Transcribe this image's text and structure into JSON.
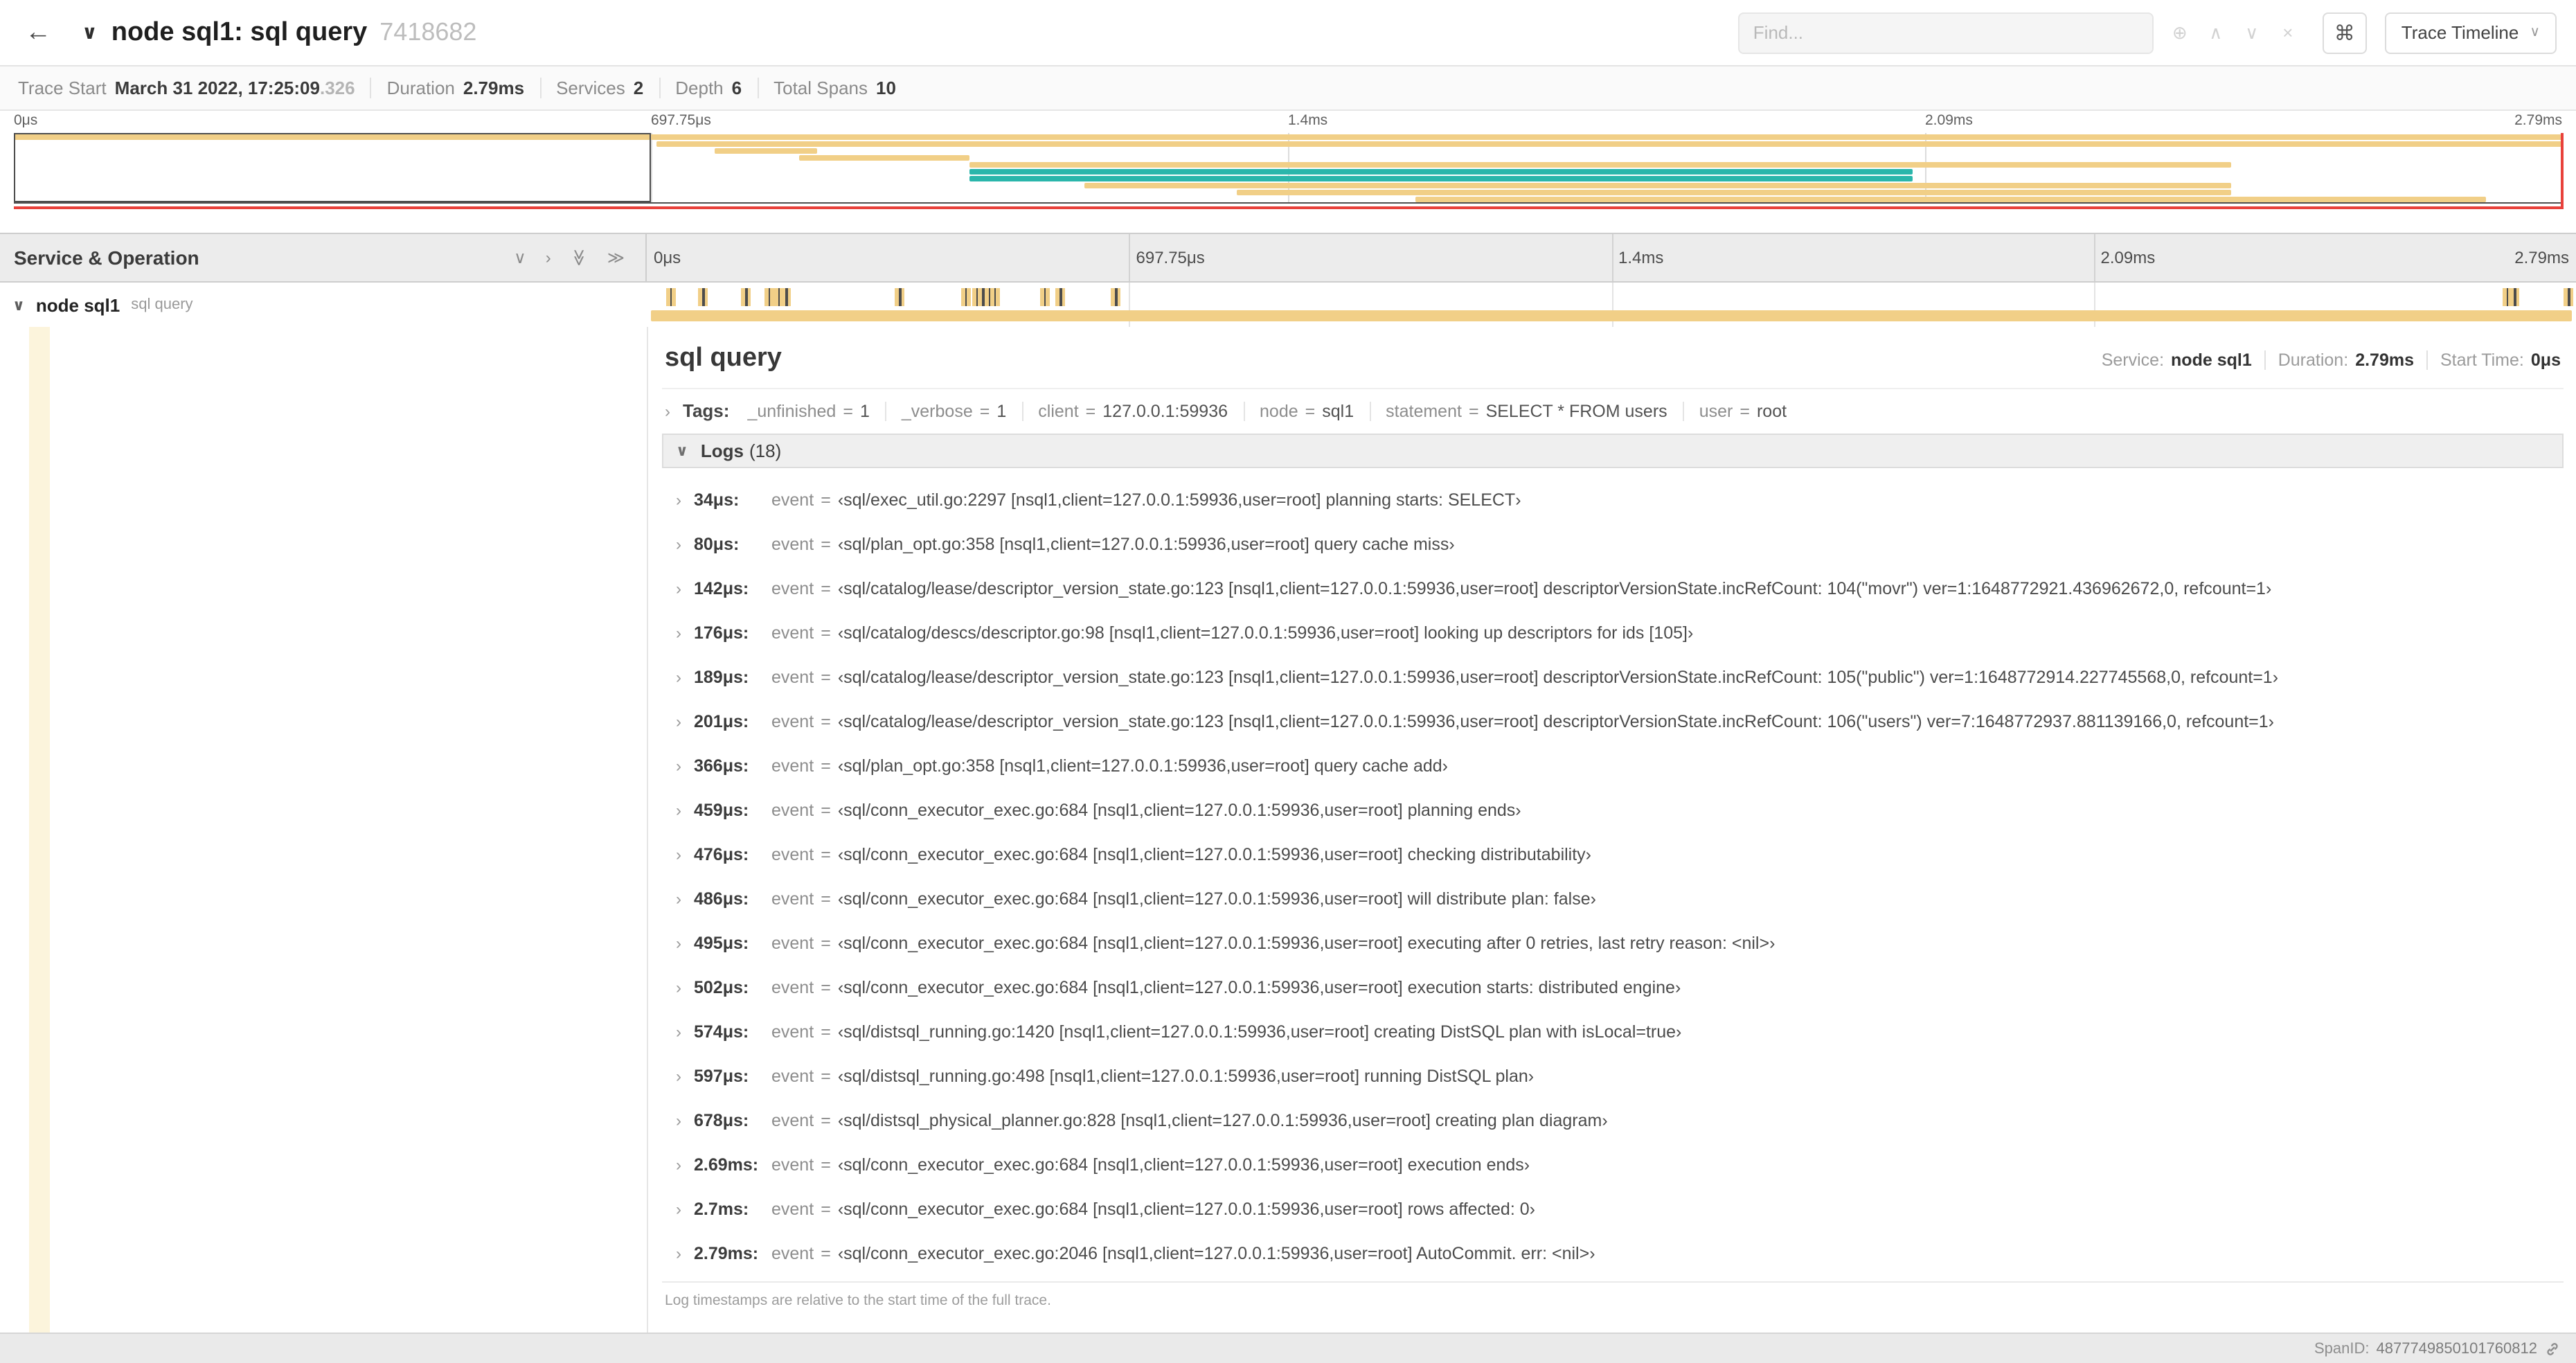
{
  "colors": {
    "amber": "#f1cf87",
    "teal": "#2ab6ab",
    "accent_red": "#e8413b",
    "indent": "#fcf4dc"
  },
  "icons": {
    "back": "←",
    "collapse": "∨",
    "expander": "›",
    "chevron_down": "∨",
    "chevron_right": "›",
    "dbl_chevron": "≫",
    "focus": "⊕",
    "prev": "∧",
    "next": "∨",
    "clear": "×",
    "cmd": "⌘",
    "dropdown": "∨"
  },
  "header": {
    "title": "node sql1: sql query",
    "trace_id": "7418682",
    "find_placeholder": "Find...",
    "view_select_label": "Trace Timeline"
  },
  "trace_info": {
    "items": [
      {
        "label": "Trace Start",
        "value": "March 31 2022, 17:25:09",
        "value_suffix": ".326"
      },
      {
        "label": "Duration",
        "value": "2.79ms"
      },
      {
        "label": "Services",
        "value": "2"
      },
      {
        "label": "Depth",
        "value": "6"
      },
      {
        "label": "Total Spans",
        "value": "10"
      }
    ]
  },
  "minimap": {
    "spans": [
      {
        "start": 0,
        "end": 100,
        "color": "amber"
      },
      {
        "start": 25.2,
        "end": 100,
        "color": "amber"
      },
      {
        "start": 27.5,
        "end": 31.5,
        "color": "amber"
      },
      {
        "start": 30.8,
        "end": 37.5,
        "color": "amber"
      },
      {
        "start": 37.5,
        "end": 87,
        "color": "amber"
      },
      {
        "start": 37.5,
        "end": 74.5,
        "color": "teal"
      },
      {
        "start": 37.5,
        "end": 74.5,
        "color": "teal"
      },
      {
        "start": 42,
        "end": 87,
        "color": "amber"
      },
      {
        "start": 48,
        "end": 87,
        "color": "amber"
      },
      {
        "start": 55,
        "end": 97,
        "color": "amber"
      }
    ]
  },
  "timeline": {
    "left_header": "Service & Operation",
    "ticks": [
      {
        "label": "0μs",
        "pct": 0
      },
      {
        "label": "697.75μs",
        "pct": 25
      },
      {
        "label": "1.4ms",
        "pct": 50
      },
      {
        "label": "2.09ms",
        "pct": 75
      },
      {
        "label": "2.79ms",
        "pct": 100
      }
    ],
    "row": {
      "service": "node sql1",
      "operation": "sql query",
      "log_tick_pcts": [
        1.2,
        2.9,
        5.1,
        6.3,
        6.8,
        7.2,
        13.1,
        16.5,
        17.1,
        17.4,
        17.7,
        18.0,
        20.6,
        21.4,
        24.3,
        96.4,
        96.8,
        99.6
      ]
    }
  },
  "detail": {
    "title": "sql query",
    "eq_sign": "=",
    "meta": [
      {
        "label": "Service:",
        "value": "node sql1"
      },
      {
        "label": "Duration:",
        "value": "2.79ms"
      },
      {
        "label": "Start Time:",
        "value": "0μs"
      }
    ],
    "tags_label": "Tags:",
    "tags": [
      {
        "key": "_unfinished",
        "value": "1"
      },
      {
        "key": "_verbose",
        "value": "1"
      },
      {
        "key": "client",
        "value": "127.0.0.1:59936"
      },
      {
        "key": "node",
        "value": "sql1"
      },
      {
        "key": "statement",
        "value": "SELECT * FROM users"
      },
      {
        "key": "user",
        "value": "root"
      }
    ],
    "logs_label": "Logs",
    "logs_count": "(18)",
    "logs": [
      {
        "time": "34μs:",
        "field": "event",
        "value": "‹sql/exec_util.go:2297 [nsql1,client=127.0.0.1:59936,user=root] planning starts: SELECT›"
      },
      {
        "time": "80μs:",
        "field": "event",
        "value": "‹sql/plan_opt.go:358 [nsql1,client=127.0.0.1:59936,user=root] query cache miss›"
      },
      {
        "time": "142μs:",
        "field": "event",
        "value": "‹sql/catalog/lease/descriptor_version_state.go:123 [nsql1,client=127.0.0.1:59936,user=root] descriptorVersionState.incRefCount: 104(\"movr\") ver=1:1648772921.436962672,0, refcount=1›"
      },
      {
        "time": "176μs:",
        "field": "event",
        "value": "‹sql/catalog/descs/descriptor.go:98 [nsql1,client=127.0.0.1:59936,user=root] looking up descriptors for ids [105]›"
      },
      {
        "time": "189μs:",
        "field": "event",
        "value": "‹sql/catalog/lease/descriptor_version_state.go:123 [nsql1,client=127.0.0.1:59936,user=root] descriptorVersionState.incRefCount: 105(\"public\") ver=1:1648772914.227745568,0, refcount=1›"
      },
      {
        "time": "201μs:",
        "field": "event",
        "value": "‹sql/catalog/lease/descriptor_version_state.go:123 [nsql1,client=127.0.0.1:59936,user=root] descriptorVersionState.incRefCount: 106(\"users\") ver=7:1648772937.881139166,0, refcount=1›"
      },
      {
        "time": "366μs:",
        "field": "event",
        "value": "‹sql/plan_opt.go:358 [nsql1,client=127.0.0.1:59936,user=root] query cache add›"
      },
      {
        "time": "459μs:",
        "field": "event",
        "value": "‹sql/conn_executor_exec.go:684 [nsql1,client=127.0.0.1:59936,user=root] planning ends›"
      },
      {
        "time": "476μs:",
        "field": "event",
        "value": "‹sql/conn_executor_exec.go:684 [nsql1,client=127.0.0.1:59936,user=root] checking distributability›"
      },
      {
        "time": "486μs:",
        "field": "event",
        "value": "‹sql/conn_executor_exec.go:684 [nsql1,client=127.0.0.1:59936,user=root] will distribute plan: false›"
      },
      {
        "time": "495μs:",
        "field": "event",
        "value": "‹sql/conn_executor_exec.go:684 [nsql1,client=127.0.0.1:59936,user=root] executing after 0 retries, last retry reason: <nil>›"
      },
      {
        "time": "502μs:",
        "field": "event",
        "value": "‹sql/conn_executor_exec.go:684 [nsql1,client=127.0.0.1:59936,user=root] execution starts: distributed engine›"
      },
      {
        "time": "574μs:",
        "field": "event",
        "value": "‹sql/distsql_running.go:1420 [nsql1,client=127.0.0.1:59936,user=root] creating DistSQL plan with isLocal=true›"
      },
      {
        "time": "597μs:",
        "field": "event",
        "value": "‹sql/distsql_running.go:498 [nsql1,client=127.0.0.1:59936,user=root] running DistSQL plan›"
      },
      {
        "time": "678μs:",
        "field": "event",
        "value": "‹sql/distsql_physical_planner.go:828 [nsql1,client=127.0.0.1:59936,user=root] creating plan diagram›"
      },
      {
        "time": "2.69ms:",
        "field": "event",
        "value": "‹sql/conn_executor_exec.go:684 [nsql1,client=127.0.0.1:59936,user=root] execution ends›"
      },
      {
        "time": "2.7ms:",
        "field": "event",
        "value": "‹sql/conn_executor_exec.go:684 [nsql1,client=127.0.0.1:59936,user=root] rows affected: 0›"
      },
      {
        "time": "2.79ms:",
        "field": "event",
        "value": "‹sql/conn_executor_exec.go:2046 [nsql1,client=127.0.0.1:59936,user=root] AutoCommit. err: <nil>›"
      }
    ],
    "footer_note": "Log timestamps are relative to the start time of the full trace.",
    "span_id_label": "SpanID:",
    "span_id": "4877749850101760812"
  }
}
